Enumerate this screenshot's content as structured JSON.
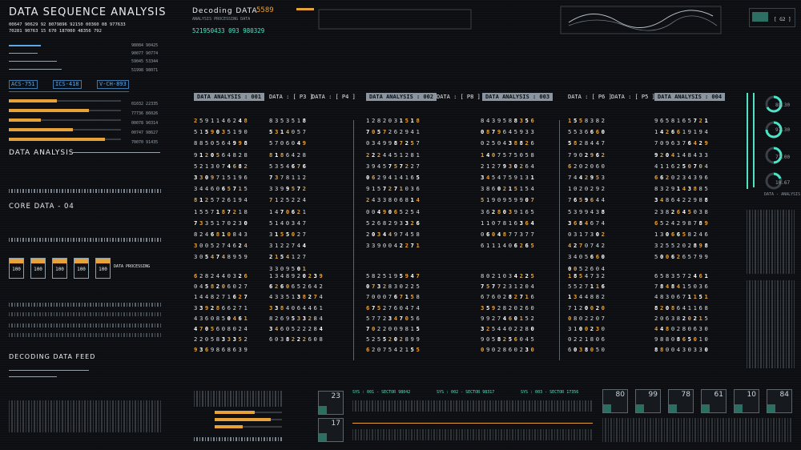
{
  "header": {
    "title": "DATA SEQUENCE ANALYSIS",
    "code_rows": [
      "00647 90629 92 8079896 92150 00360 08 977633",
      "70281 90763 15 670 187000 48356 792"
    ],
    "decoding_label": "Decoding DATA",
    "decoding_value": "5589",
    "analysis_processing": "ANALYSIS PROCESSING DATA",
    "stream": "521950433 093 980329"
  },
  "sidebar": {
    "tags": [
      "ACS-751",
      "ICS-418",
      "V-CH-893"
    ],
    "data_analysis": "DATA ANALYSIS",
    "core_data": "CORE DATA - 04",
    "data_processing": "DATA PROCESSING",
    "decoding_feed": "DECODING DATA FEED",
    "cards": [
      "100",
      "100",
      "100",
      "100",
      "100"
    ],
    "top_nums": [
      "98084 90425",
      "90077 90774",
      "59045 53344",
      "51998 98071"
    ],
    "mid_nums": [
      "01032 22335",
      "77736 86026",
      "00078 90314",
      "00747 98627",
      "70070 91435"
    ]
  },
  "main": {
    "headers": [
      {
        "label": "DATA ANALYSIS : 001",
        "boxed": true
      },
      {
        "label": "DATA : [ P3 ]",
        "boxed": false
      },
      {
        "label": "DATA : [ P4 ]",
        "boxed": false
      },
      {
        "label": "DATA ANALYSIS : 002",
        "boxed": true
      },
      {
        "label": "DATA : [ P8 ]",
        "boxed": false
      },
      {
        "label": "DATA ANALYSIS : 003",
        "boxed": true
      },
      {
        "label": "DATA : [ P6 ]",
        "boxed": false
      },
      {
        "label": "DATA : [ P5 ]",
        "boxed": false
      },
      {
        "label": "DATA ANALYSIS : 004",
        "boxed": true
      }
    ],
    "block1": [
      "2591146248",
      "5159035190",
      "8850564998",
      "9120564828",
      "5213074682",
      "3309715196",
      "3446065715",
      "8125726194",
      "1557187218",
      "7335170230",
      "8246810843",
      "3005274624",
      "3054748959"
    ],
    "block2": [
      "8353518",
      "5314057",
      "5706049",
      "8186428",
      "5354676",
      "7378112",
      "3399572",
      "7125224",
      "1470621",
      "5140347",
      "3155027",
      "3122744",
      "2154127",
      "3309501"
    ],
    "block3": [
      "1282031518",
      "7057262941",
      "0349987257",
      "2224451281",
      "3945757227",
      "0629414165",
      "9157271036",
      "2433806814",
      "0049065254",
      "5268293326",
      "2034497458",
      "3390042271"
    ],
    "block4": [
      "8439588356",
      "0879645933",
      "0250438826",
      "1407575058",
      "2127930264",
      "3454759131",
      "3860215154",
      "5190959907",
      "3628039165",
      "1107816364",
      "0604877377",
      "6111406265"
    ],
    "block5": [
      "1558382",
      "5536660",
      "5828447",
      "7902962",
      "6202060",
      "7442953",
      "1020292",
      "7659644",
      "5399438",
      "3684674",
      "0317302",
      "4270742",
      "3405660",
      "0052604"
    ],
    "block6": [
      "9658165721",
      "1426619194",
      "7096376429",
      "9204148433",
      "4116250704",
      "6620234396",
      "8329143885",
      "3486422988",
      "2382645038",
      "6524298789",
      "1306658246",
      "3255202898",
      "5006265799"
    ],
    "lower1": [
      "6282440326",
      "0458206027",
      "1448271627",
      "3392866271",
      "4360850461",
      "4705608024",
      "2205833352",
      "9369868639"
    ],
    "lower2": [
      "1348920239",
      "6260652642",
      "4335138274",
      "3384064461",
      "8269533284",
      "3460522284",
      "6038222608"
    ],
    "lower3": [
      "5825195947",
      "0732830225",
      "7000767158",
      "6752760474",
      "5772347056",
      "7022009815",
      "5255202899",
      "6207542155"
    ],
    "lower4": [
      "8021034225",
      "7577231204",
      "6760282716",
      "3592820260",
      "9927460152",
      "3254402280",
      "9058256045",
      "0902860230"
    ],
    "lower5": [
      "1854732",
      "5527116",
      "1344882",
      "7120020",
      "0802207",
      "3100230",
      "0221806",
      "6038050"
    ],
    "lower6": [
      "6583572461",
      "7848415036",
      "4830671151",
      "8208641168",
      "2063820215",
      "4480280630",
      "9880865010",
      "8800430330"
    ]
  },
  "right_panel": {
    "rings": [
      "88.30",
      "97.30",
      "72.00",
      "10.67"
    ],
    "data_analysis": "DATA - ANALYSIS"
  },
  "footer": {
    "sectors": [
      "SYS : 001 - SECTOR 98042",
      "SYS : 002 - SECTOR 98317",
      "SYS : 003 - SECTOR 17356"
    ],
    "tiles": [
      "23",
      "17",
      "80",
      "99",
      "78",
      "61",
      "10",
      "84"
    ]
  }
}
